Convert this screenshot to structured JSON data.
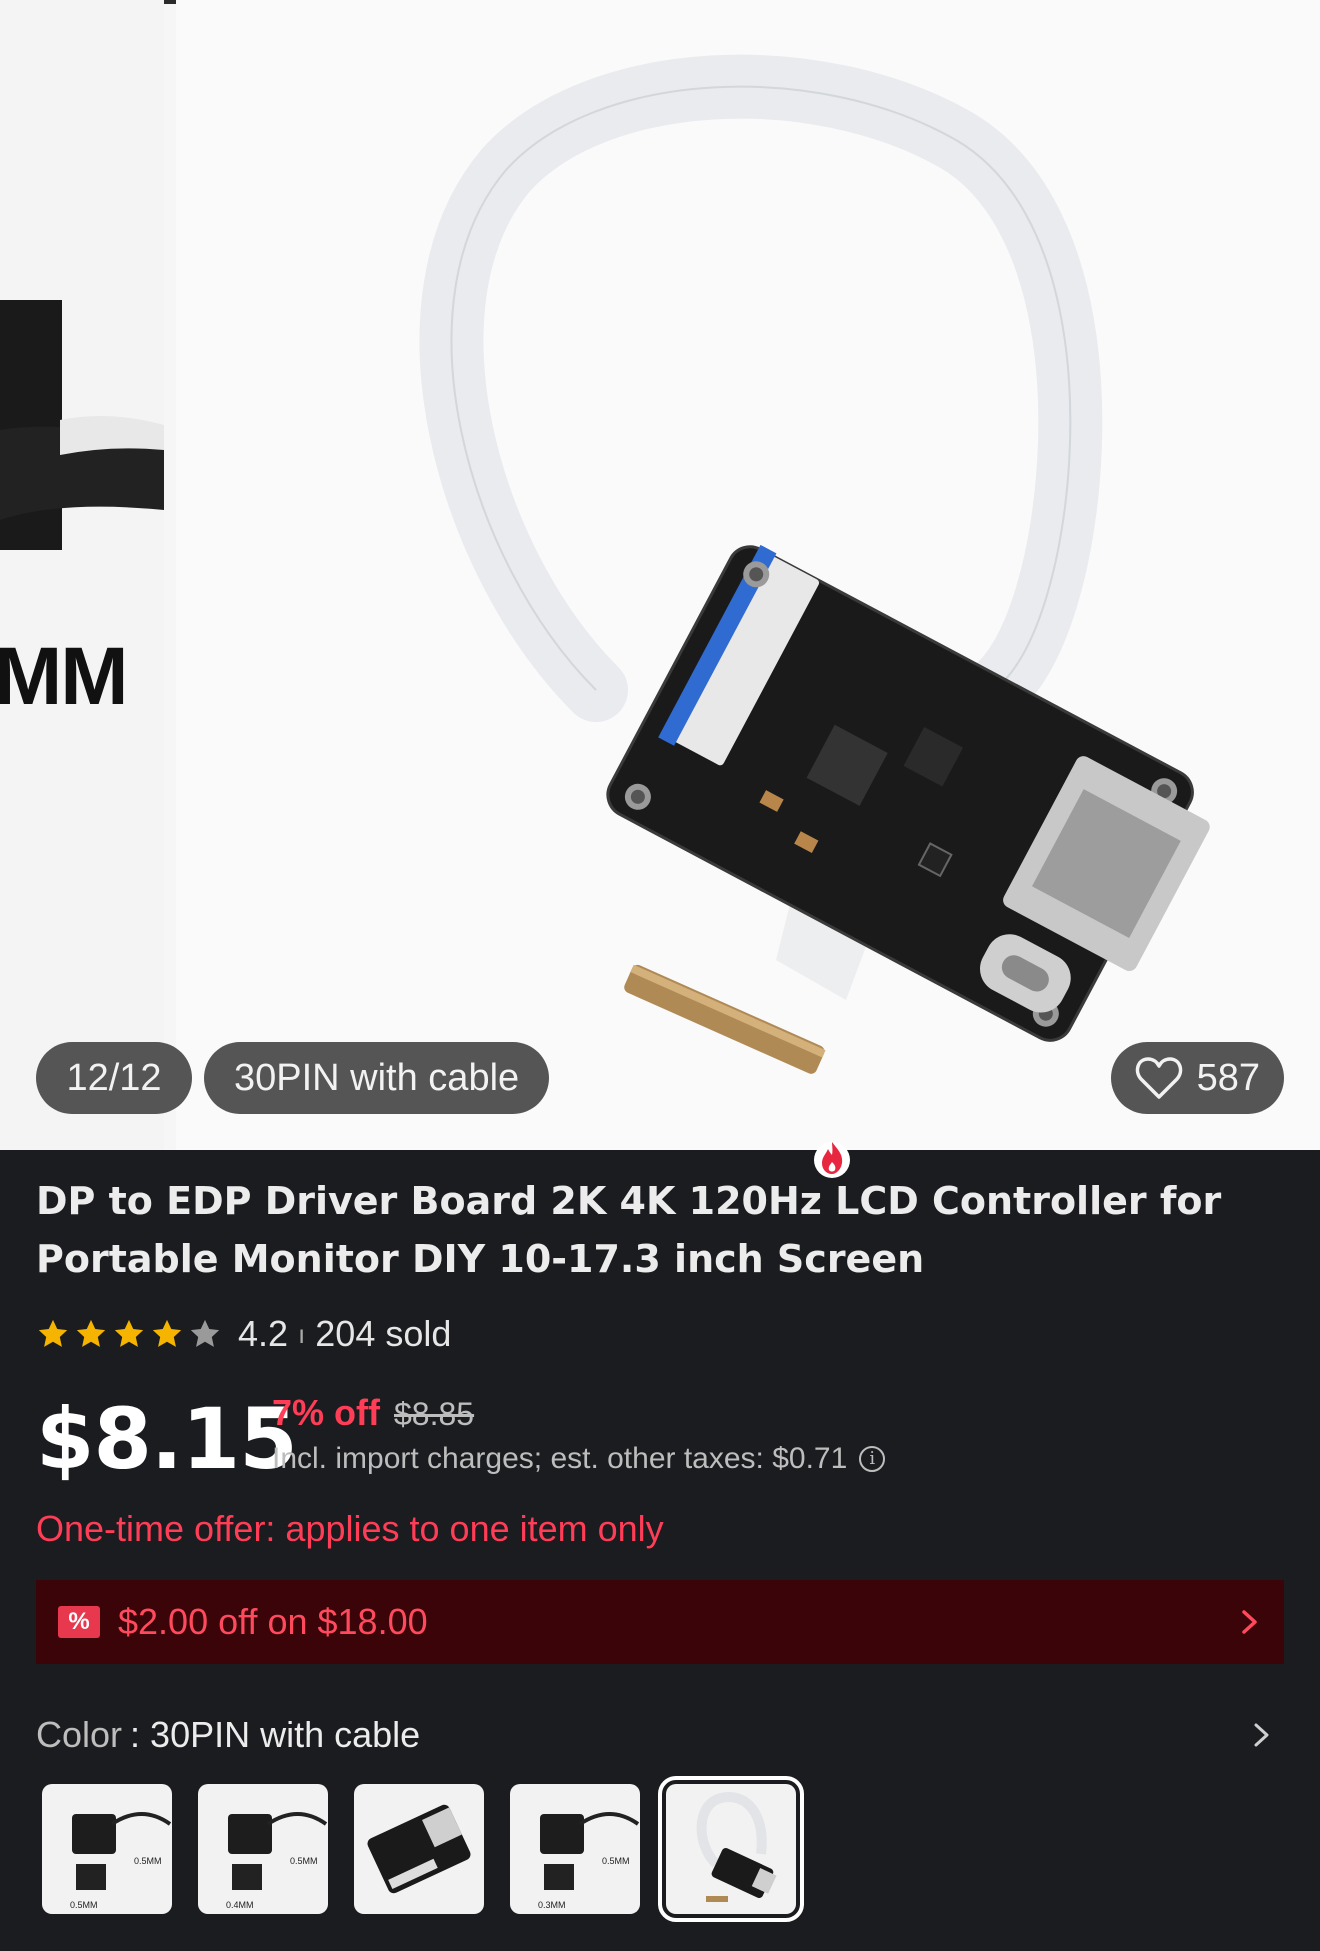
{
  "gallery": {
    "counter": "12/12",
    "variant_label": "30PIN with cable",
    "favorites_count": "587",
    "prev_slide_text": "MM"
  },
  "product": {
    "title": "DP to EDP Driver Board 2K 4K 120Hz LCD Controller for Portable Monitor DIY 10-17.3 inch Screen",
    "rating": "4.2",
    "rating_stars": 4.2,
    "sold": "204 sold",
    "price": "$8.15",
    "discount": "7% off",
    "original_price": "$8.85",
    "taxes_note": "Incl. import charges; est. other taxes: $0.71",
    "offer_note": "One-time offer: applies to one item only"
  },
  "coupon": {
    "icon": "coupon-icon",
    "text": "$2.00 off on $18.00"
  },
  "color": {
    "label": "Color",
    "separator": " : ",
    "value": "30PIN with cable",
    "options": [
      {
        "caption_a": "0.5MM",
        "caption_b": "0.5MM"
      },
      {
        "caption_a": "0.4MM",
        "caption_b": "0.5MM"
      },
      {
        "caption_a": "",
        "caption_b": ""
      },
      {
        "caption_a": "0.3MM",
        "caption_b": "0.5MM"
      },
      {
        "caption_a": "",
        "caption_b": ""
      }
    ],
    "selected_index": 4
  },
  "colors": {
    "accent_red": "#ff3d57",
    "coupon_bg": "#3a0408",
    "star": "#f5b400",
    "background": "#1b1c1f"
  }
}
